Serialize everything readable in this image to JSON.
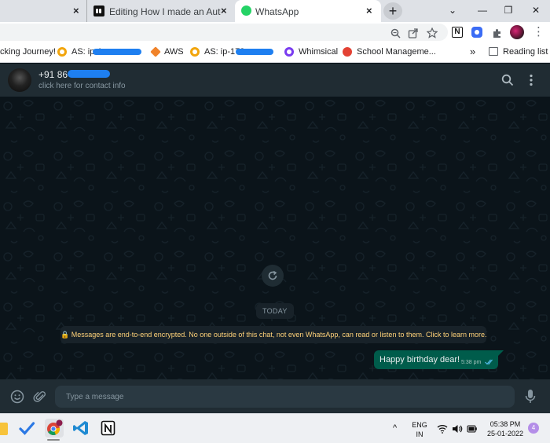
{
  "browser": {
    "tabs": [
      {
        "title": ""
      },
      {
        "title": "Editing How I made an Automati"
      },
      {
        "title": "WhatsApp"
      }
    ],
    "tab_close_glyph": "×",
    "new_tab_glyph": "+",
    "window_controls": {
      "dropdown": "⌄",
      "minimize": "—",
      "restore": "❐",
      "close": "✕"
    },
    "ext_notion_letter": "N",
    "menu_glyph": "⋮"
  },
  "bookmarks": [
    {
      "label": "cking Journey!"
    },
    {
      "label": "AS: ip-1"
    },
    {
      "label": "AWS"
    },
    {
      "label": "AS: ip-172"
    },
    {
      "label": "Whimsical"
    },
    {
      "label": "School Manageme..."
    }
  ],
  "bookmarks_overflow": "»",
  "reading_list": "Reading list",
  "chat": {
    "contact_name": "+91 86",
    "contact_subtitle": "click here for contact info",
    "date_chip": "TODAY",
    "encryption_notice": "🔒 Messages are end-to-end encrypted. No one outside of this chat, not even WhatsApp, can read or listen to them. Click to learn more.",
    "messages": [
      {
        "text": "Happy birthday dear!",
        "time": "5:38 pm",
        "status": "read"
      }
    ]
  },
  "composer": {
    "placeholder": "Type a message"
  },
  "taskbar": {
    "lang_line1": "ENG",
    "lang_line2": "IN",
    "time": "05:38 PM",
    "date": "25-01-2022",
    "notification_count": "4",
    "chevron": "^"
  },
  "colors": {
    "wa_header": "#202c33",
    "wa_background": "#0b141a",
    "outgoing_bubble": "#005c4b",
    "encryption_text": "#ffd279",
    "read_ticks": "#53bdeb"
  }
}
